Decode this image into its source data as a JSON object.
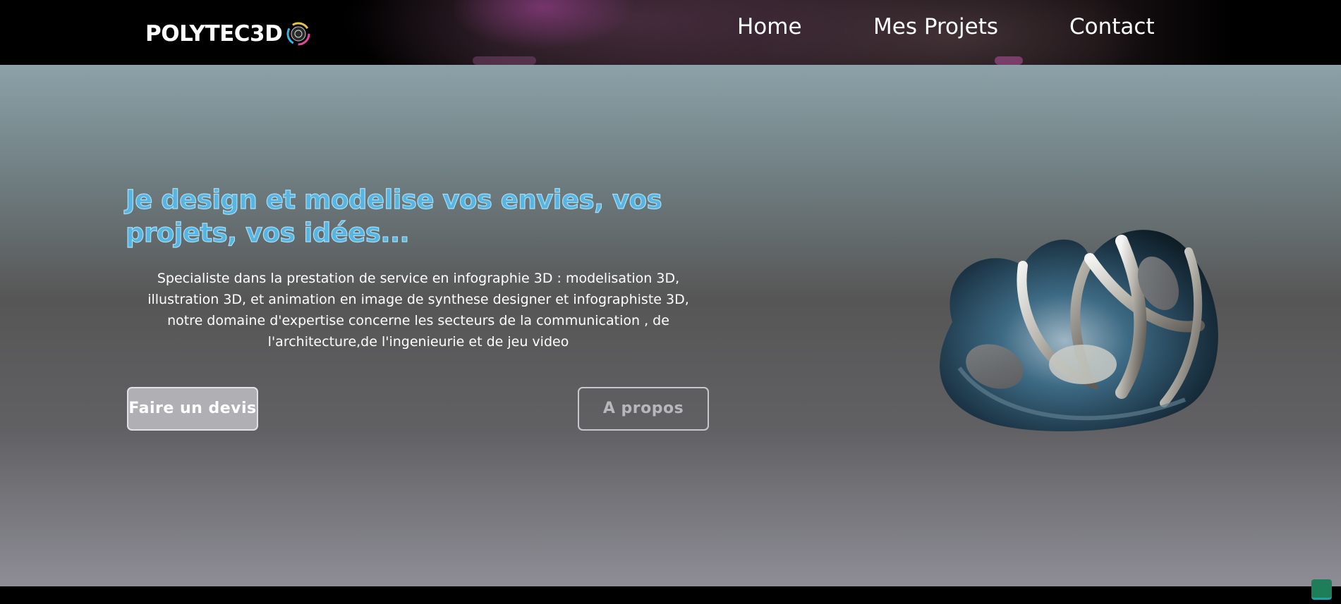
{
  "header": {
    "logo_text": "POLYTEC3D",
    "logo_icon": "polytec3d-badge-icon",
    "nav": [
      {
        "label": "Home"
      },
      {
        "label": "Mes Projets"
      },
      {
        "label": "Contact"
      }
    ]
  },
  "hero": {
    "title": "Je design et modelise vos envies, vos projets, vos idées...",
    "description": "Specialiste dans la prestation de service en infographie 3D : modelisation 3D, illustration 3D, et animation en image de synthese designer et infographiste 3D, notre domaine d'expertise concerne les secteurs de la communication , de l'architecture,de l'ingenieurie et de jeu video",
    "buttons": {
      "devis": "Faire un devis",
      "apropos": "A propos"
    },
    "image_icon": "abstract-3d-sculpture"
  },
  "colors": {
    "title": "#58b4e0",
    "title_outline": "#a9ddf3",
    "chat_widget": "#1e7e5a"
  },
  "widgets": {
    "chat_icon": "chat-widget-icon"
  }
}
